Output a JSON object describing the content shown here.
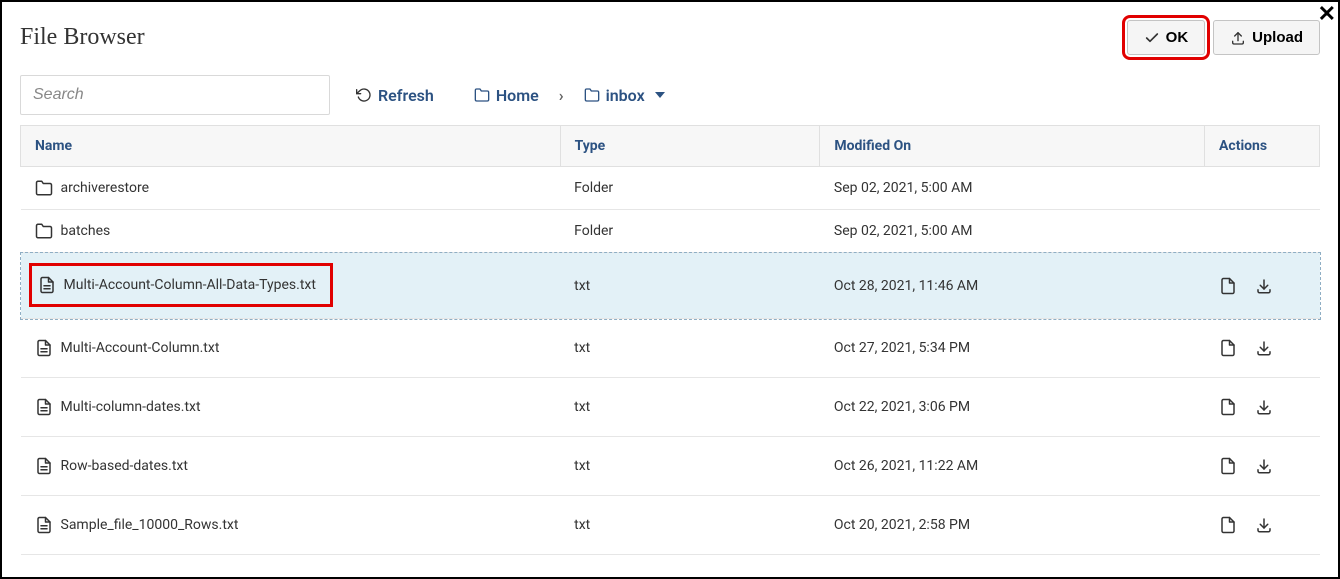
{
  "header": {
    "title": "File Browser",
    "ok_label": "OK",
    "upload_label": "Upload"
  },
  "toolbar": {
    "search_placeholder": "Search",
    "refresh_label": "Refresh",
    "home_label": "Home",
    "current_folder": "inbox"
  },
  "table": {
    "columns": {
      "name": "Name",
      "type": "Type",
      "modified": "Modified On",
      "actions": "Actions"
    },
    "rows": [
      {
        "name": "archiverestore",
        "type": "Folder",
        "modified": "Sep 02, 2021, 5:00 AM",
        "is_folder": true,
        "selected": false,
        "has_actions": false
      },
      {
        "name": "batches",
        "type": "Folder",
        "modified": "Sep 02, 2021, 5:00 AM",
        "is_folder": true,
        "selected": false,
        "has_actions": false
      },
      {
        "name": "Multi-Account-Column-All-Data-Types.txt",
        "type": "txt",
        "modified": "Oct 28, 2021, 11:46 AM",
        "is_folder": false,
        "selected": true,
        "has_actions": true,
        "highlighted": true
      },
      {
        "name": "Multi-Account-Column.txt",
        "type": "txt",
        "modified": "Oct 27, 2021, 5:34 PM",
        "is_folder": false,
        "selected": false,
        "has_actions": true
      },
      {
        "name": "Multi-column-dates.txt",
        "type": "txt",
        "modified": "Oct 22, 2021, 3:06 PM",
        "is_folder": false,
        "selected": false,
        "has_actions": true
      },
      {
        "name": "Row-based-dates.txt",
        "type": "txt",
        "modified": "Oct 26, 2021, 11:22 AM",
        "is_folder": false,
        "selected": false,
        "has_actions": true
      },
      {
        "name": "Sample_file_10000_Rows.txt",
        "type": "txt",
        "modified": "Oct 20, 2021, 2:58 PM",
        "is_folder": false,
        "selected": false,
        "has_actions": true
      }
    ]
  }
}
